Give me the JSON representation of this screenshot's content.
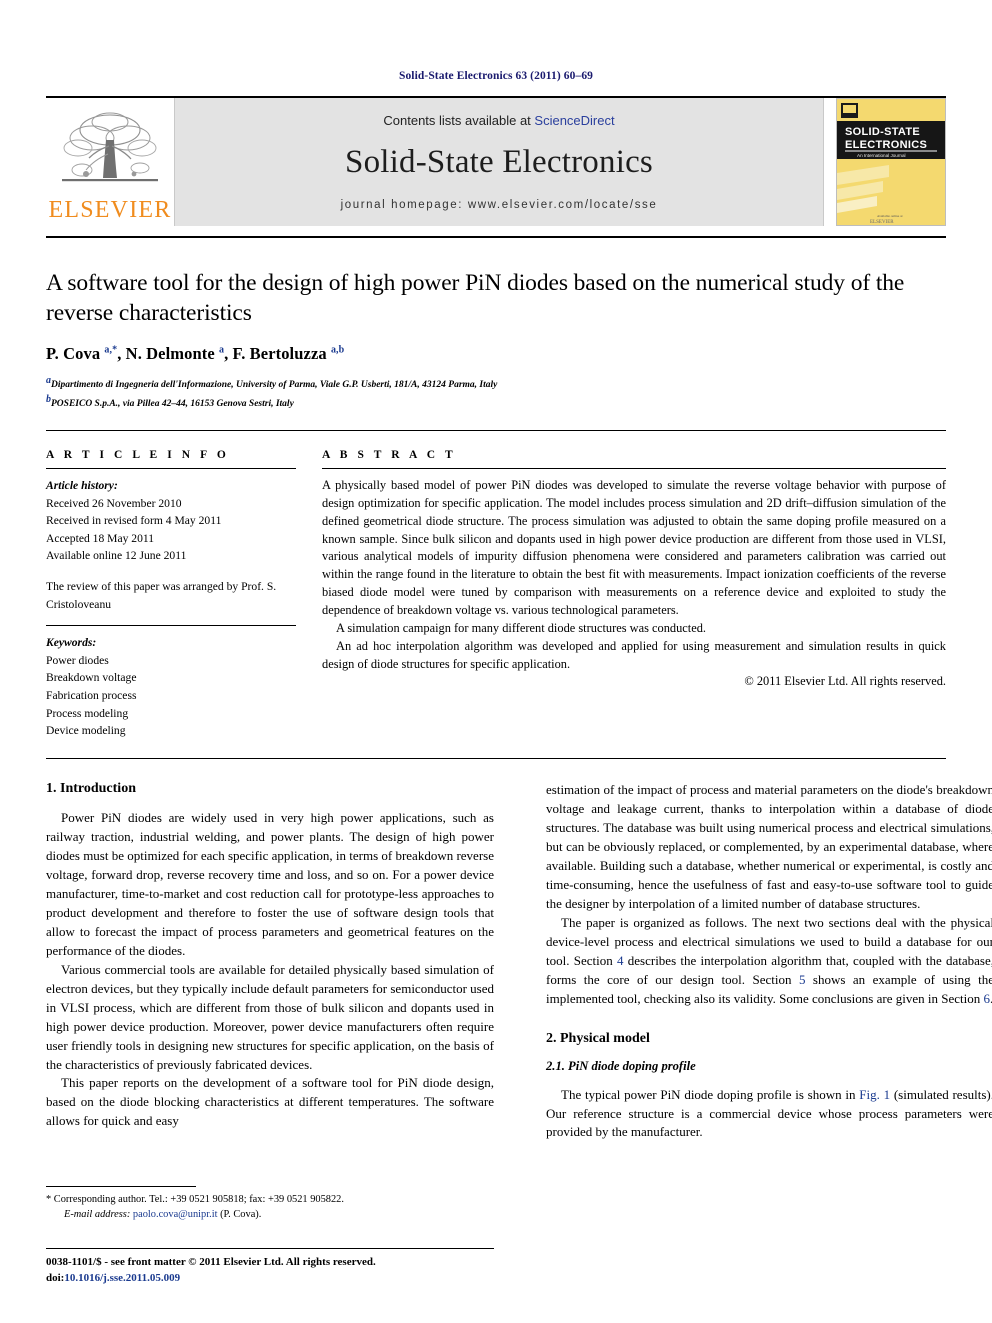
{
  "running_head": "Solid-State Electronics 63 (2011) 60–69",
  "masthead": {
    "publisher_name": "ELSEVIER",
    "contents_prefix": "Contents lists available at ",
    "contents_link": "ScienceDirect",
    "journal_title": "Solid-State Electronics",
    "homepage": "journal homepage: www.elsevier.com/locate/sse",
    "cover": {
      "line1": "SOLID-STATE",
      "line2": "ELECTRONICS",
      "line3": "An International Journal",
      "footer": "ELSEVIER"
    },
    "link_color": "#2a3f9d",
    "brand_color": "#F08C1E",
    "cover_yellow": "#f3d469"
  },
  "article": {
    "title": "A software tool for the design of high power PiN diodes based on the numerical study of the reverse characteristics",
    "authors_html": "P. Cova <sup>a,*</sup>, N. Delmonte <sup>a</sup>, F. Bertoluzza <sup>a,b</sup>",
    "affiliations": [
      "Dipartimento di Ingegneria dell'Informazione, University of Parma, Viale G.P. Usberti, 181/A, 43124 Parma, Italy",
      "POSEICO S.p.A., via Pillea 42–44, 16153 Genova Sestri, Italy"
    ],
    "affiliation_marks": [
      "a",
      "b"
    ]
  },
  "article_info": {
    "heading": "A R T I C L E   I N F O",
    "history_label": "Article history:",
    "history": [
      "Received 26 November 2010",
      "Received in revised form 4 May 2011",
      "Accepted 18 May 2011",
      "Available online 12 June 2011"
    ],
    "editor_note": "The review of this paper was arranged by Prof. S. Cristoloveanu",
    "keywords_label": "Keywords:",
    "keywords": [
      "Power diodes",
      "Breakdown voltage",
      "Fabrication process",
      "Process modeling",
      "Device modeling"
    ]
  },
  "abstract": {
    "heading": "A B S T R A C T",
    "paragraphs": [
      "A physically based model of power PiN diodes was developed to simulate the reverse voltage behavior with purpose of design optimization for specific application. The model includes process simulation and 2D drift–diffusion simulation of the defined geometrical diode structure. The process simulation was adjusted to obtain the same doping profile measured on a known sample. Since bulk silicon and dopants used in high power device production are different from those used in VLSI, various analytical models of impurity diffusion phenomena were considered and parameters calibration was carried out within the range found in the literature to obtain the best fit with measurements. Impact ionization coefficients of the reverse biased diode model were tuned by comparison with measurements on a reference device and exploited to study the dependence of breakdown voltage vs. various technological parameters.",
      "A simulation campaign for many different diode structures was conducted.",
      "An ad hoc interpolation algorithm was developed and applied for using measurement and simulation results in quick design of diode structures for specific application."
    ],
    "copyright": "© 2011 Elsevier Ltd. All rights reserved."
  },
  "body": {
    "left": {
      "section_heading": "1. Introduction",
      "paragraphs": [
        "Power PiN diodes are widely used in very high power applications, such as railway traction, industrial welding, and power plants. The design of high power diodes must be optimized for each specific application, in terms of breakdown reverse voltage, forward drop, reverse recovery time and loss, and so on. For a power device manufacturer, time-to-market and cost reduction call for prototype-less approaches to product development and therefore to foster the use of software design tools that allow to forecast the impact of process parameters and geometrical features on the performance of the diodes.",
        "Various commercial tools are available for detailed physically based simulation of electron devices, but they typically include default parameters for semiconductor used in VLSI process, which are different from those of bulk silicon and dopants used in high power device production. Moreover, power device manufacturers often require user friendly tools in designing new structures for specific application, on the basis of the characteristics of previously fabricated devices.",
        "This paper reports on the development of a software tool for PiN diode design, based on the diode blocking characteristics at different temperatures. The software allows for quick and easy"
      ]
    },
    "right": {
      "para_continued": "estimation of the impact of process and material parameters on the diode's breakdown voltage and leakage current, thanks to interpolation within a database of diode structures. The database was built using numerical process and electrical simulations, but can be obviously replaced, or complemented, by an experimental database, where available. Building such a database, whether numerical or experimental, is costly and time-consuming, hence the usefulness of fast and easy-to-use software tool to guide the designer by interpolation of a limited number of database structures.",
      "para_organization_1": "The paper is organized as follows. The next two sections deal with the physical device-level process and electrical simulations we used to build a database for our tool. Section ",
      "link_4": "4",
      "para_organization_2": " describes the interpolation algorithm that, coupled with the database, forms the core of our design tool. Section ",
      "link_5": "5",
      "para_organization_3": " shows an example of using the implemented tool, checking also its validity. Some conclusions are given in Section ",
      "link_6": "6",
      "para_organization_4": ".",
      "section_heading": "2. Physical model",
      "subsection_heading": "2.1. PiN diode doping profile",
      "para_doping_1": "The typical power PiN diode doping profile is shown in ",
      "link_fig1": "Fig. 1",
      "para_doping_2": " (simulated results). Our reference structure is a commercial device whose process parameters were provided by the manufacturer."
    }
  },
  "footnote": {
    "corresponding_prefix": "* Corresponding author. Tel.: +39 0521 905818; fax: +39 0521 905822.",
    "email_label": "E-mail address:",
    "email": "paolo.cova@unipr.it",
    "email_suffix": " (P. Cova)."
  },
  "footer": {
    "issn_line": "0038-1101/$ - see front matter © 2011 Elsevier Ltd. All rights reserved.",
    "doi_label": "doi:",
    "doi": "10.1016/j.sse.2011.05.009"
  }
}
